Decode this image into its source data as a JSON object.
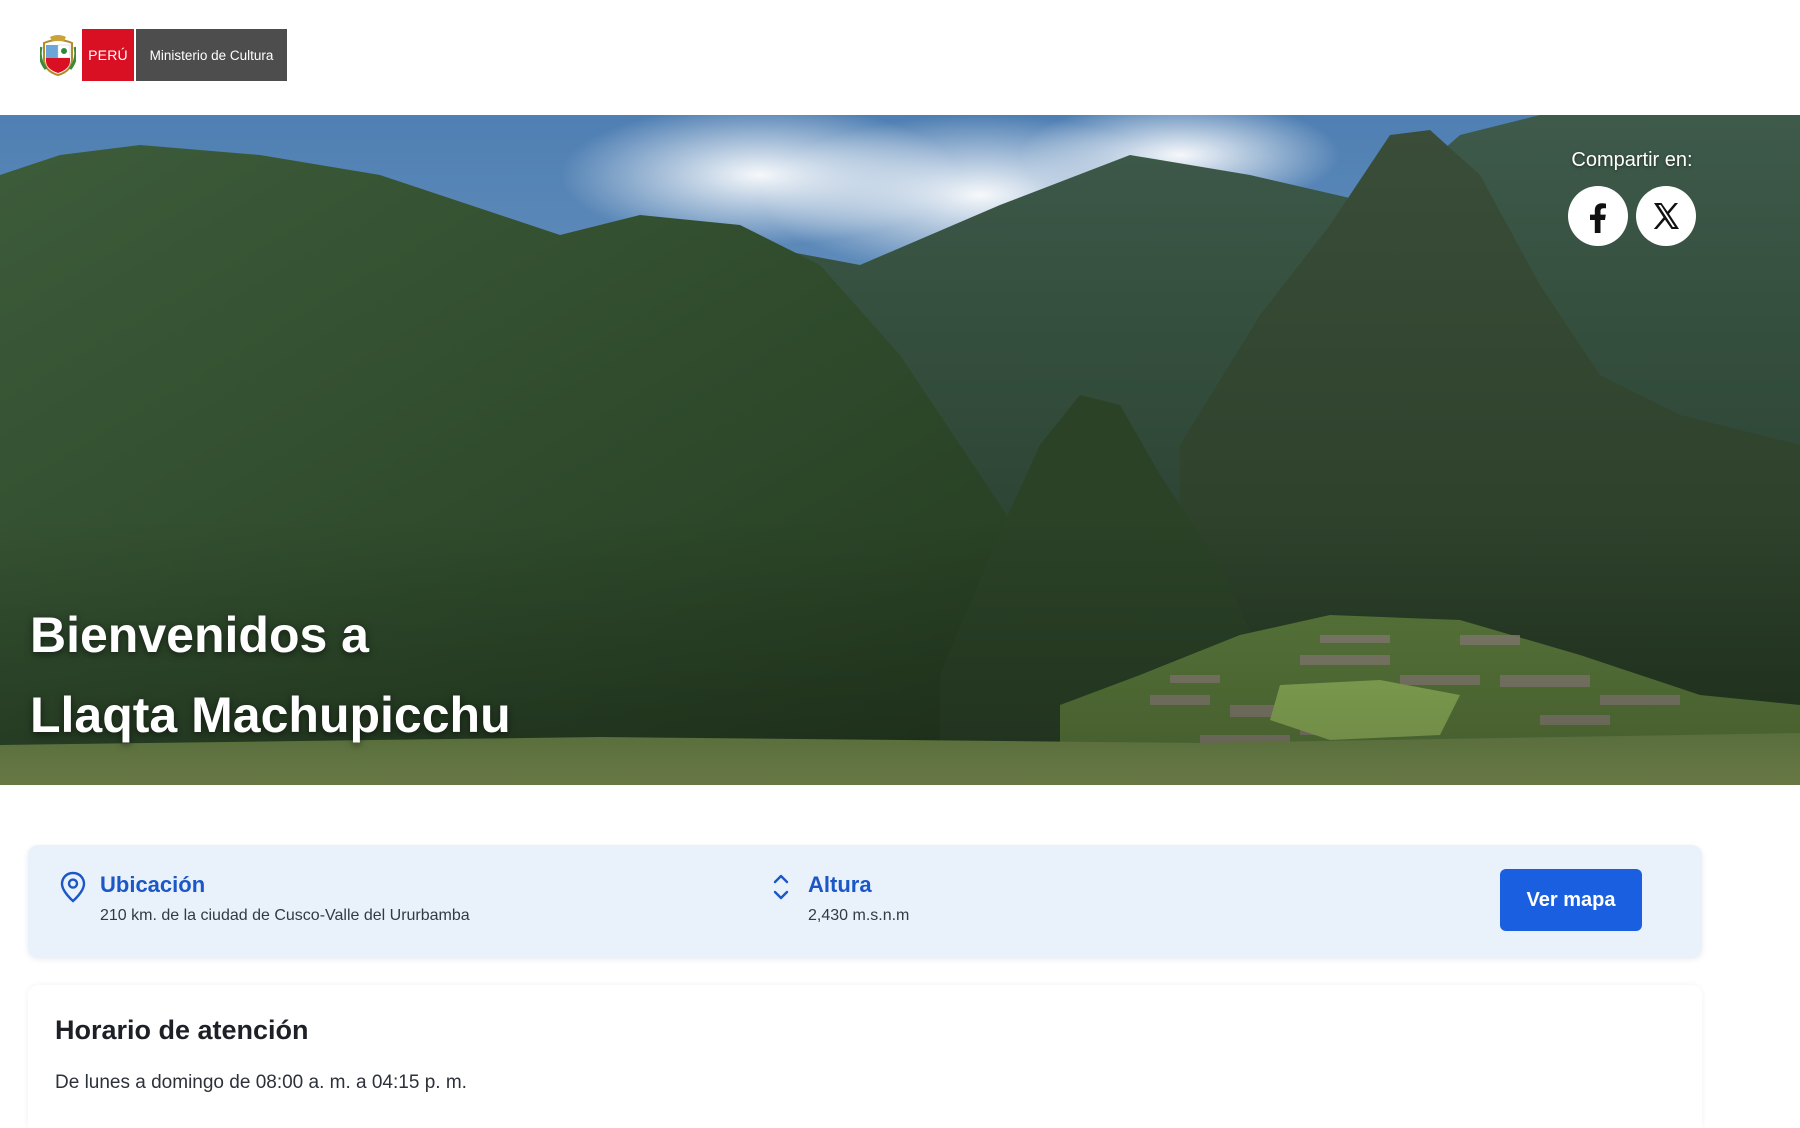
{
  "header": {
    "logo": {
      "country": "PERÚ",
      "ministry": "Ministerio de Cultura",
      "shield_icon": "peru-coat-of-arms-icon"
    }
  },
  "hero": {
    "title_line1": "Bienvenidos a",
    "title_line2": "Llaqta Machupicchu",
    "share": {
      "label": "Compartir en:",
      "icons": [
        "facebook-icon",
        "x-icon"
      ]
    }
  },
  "info": {
    "location": {
      "title": "Ubicación",
      "value": "210 km. de la ciudad de Cusco-Valle del Ururbamba",
      "icon": "location-pin-icon"
    },
    "altitude": {
      "title": "Altura",
      "value": "2,430 m.s.n.m",
      "icon": "up-down-chevron-icon"
    },
    "map_button": "Ver mapa"
  },
  "schedule": {
    "title": "Horario de atención",
    "text": "De lunes a domingo de 08:00 a. m. a 04:15 p. m."
  },
  "colors": {
    "accent": "#1a5fe0",
    "info_title": "#1b57c7",
    "info_bg": "#e9f1fb",
    "peru_red": "#d91023",
    "ministry_gray": "#4d4d4d"
  }
}
